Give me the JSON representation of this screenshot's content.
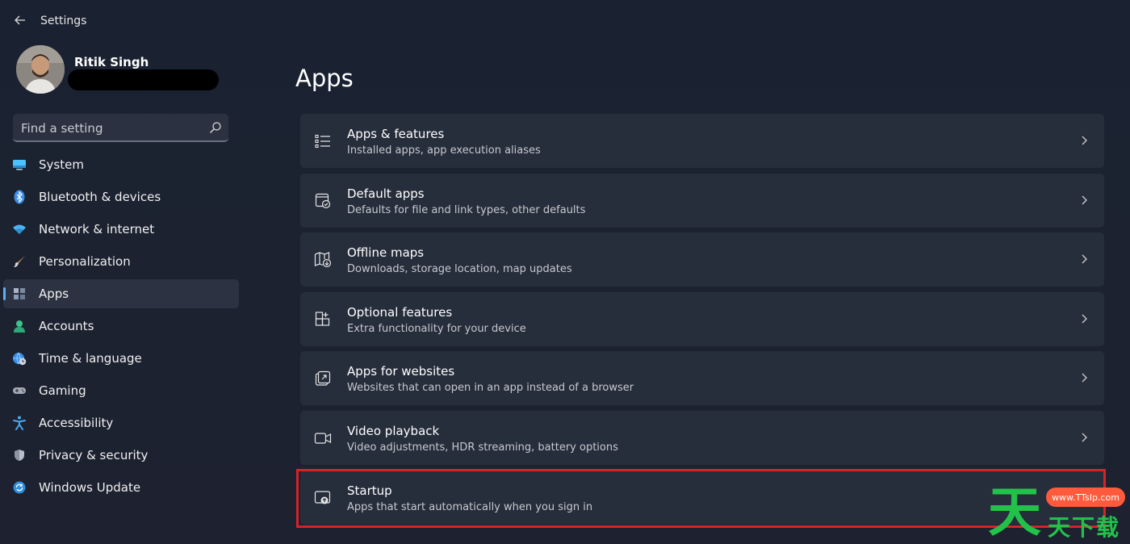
{
  "window": {
    "title": "Settings"
  },
  "profile": {
    "name": "Ritik Singh"
  },
  "search": {
    "placeholder": "Find a setting"
  },
  "sidebar": {
    "items": [
      {
        "label": "System",
        "icon": "monitor-icon"
      },
      {
        "label": "Bluetooth & devices",
        "icon": "bluetooth-icon"
      },
      {
        "label": "Network & internet",
        "icon": "wifi-icon"
      },
      {
        "label": "Personalization",
        "icon": "brush-icon"
      },
      {
        "label": "Apps",
        "icon": "apps-icon",
        "active": true
      },
      {
        "label": "Accounts",
        "icon": "person-icon"
      },
      {
        "label": "Time & language",
        "icon": "globe-clock-icon"
      },
      {
        "label": "Gaming",
        "icon": "gamepad-icon"
      },
      {
        "label": "Accessibility",
        "icon": "accessibility-icon"
      },
      {
        "label": "Privacy & security",
        "icon": "shield-icon"
      },
      {
        "label": "Windows Update",
        "icon": "update-icon"
      }
    ]
  },
  "main": {
    "title": "Apps",
    "cards": [
      {
        "title": "Apps & features",
        "subtitle": "Installed apps, app execution aliases",
        "icon": "list-icon"
      },
      {
        "title": "Default apps",
        "subtitle": "Defaults for file and link types, other defaults",
        "icon": "default-apps-icon"
      },
      {
        "title": "Offline maps",
        "subtitle": "Downloads, storage location, map updates",
        "icon": "map-download-icon"
      },
      {
        "title": "Optional features",
        "subtitle": "Extra functionality for your device",
        "icon": "add-feature-icon"
      },
      {
        "title": "Apps for websites",
        "subtitle": "Websites that can open in an app instead of a browser",
        "icon": "open-in-app-icon"
      },
      {
        "title": "Video playback",
        "subtitle": "Video adjustments, HDR streaming, battery options",
        "icon": "video-icon"
      },
      {
        "title": "Startup",
        "subtitle": "Apps that start automatically when you sign in",
        "icon": "startup-icon",
        "highlighted": true
      }
    ]
  },
  "watermark": {
    "url": "www.TTsIp.com",
    "big": "天",
    "small": "天下载"
  },
  "colors": {
    "accent": "#5fb2f2",
    "highlight": "#d6232a",
    "background": "#1c2230",
    "card": "#262d3b"
  }
}
